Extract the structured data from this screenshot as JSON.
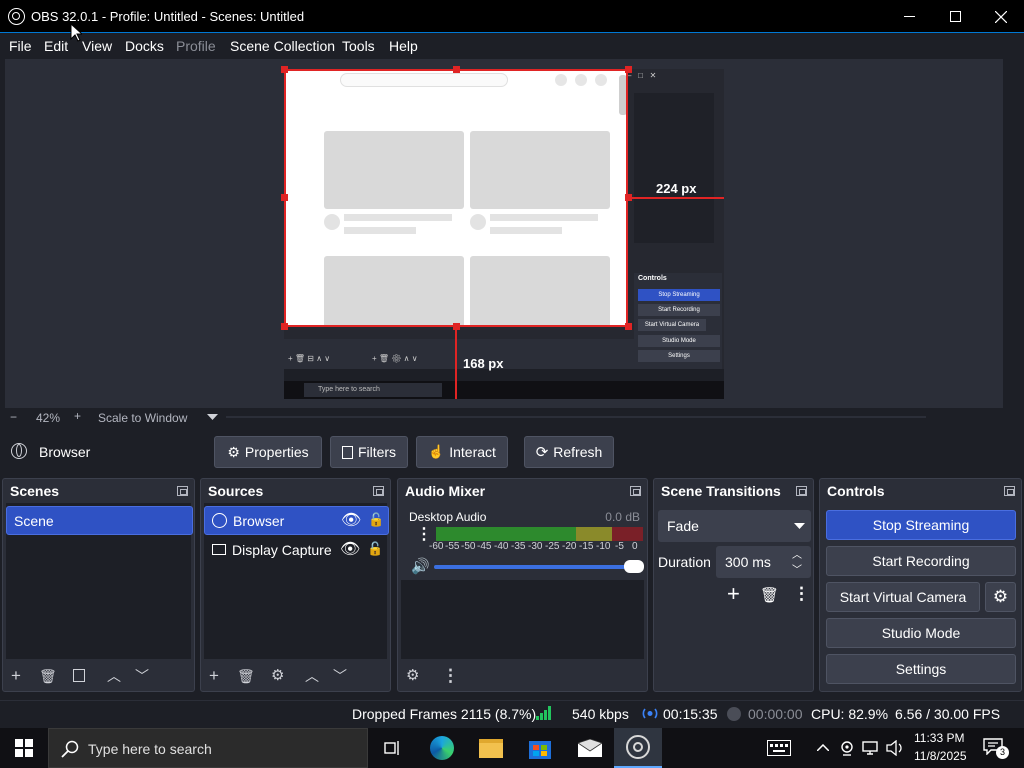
{
  "titlebar": {
    "title": "OBS 32.0.1 - Profile: Untitled - Scenes: Untitled"
  },
  "menu": {
    "items": [
      "File",
      "Edit",
      "View",
      "Docks",
      "Profile",
      "Scene Collection",
      "Tools",
      "Help"
    ]
  },
  "preview": {
    "crop_right_label": "224 px",
    "crop_bottom_label": "168 px",
    "inner_controls_title": "Controls",
    "inner_buttons": [
      "Stop Streaming",
      "Start Recording",
      "Start Virtual Camera",
      "Studio Mode",
      "Settings"
    ],
    "inner_search": "Type here to search"
  },
  "zoombar": {
    "minus": "−",
    "zoom": "42%",
    "plus": "+",
    "mode": "Scale to Window"
  },
  "source_toolbar": {
    "selected_source": "Browser",
    "properties": "Properties",
    "filters": "Filters",
    "interact": "Interact",
    "refresh": "Refresh"
  },
  "scenes": {
    "title": "Scenes",
    "items": [
      "Scene"
    ]
  },
  "sources": {
    "title": "Sources",
    "items": [
      "Browser",
      "Display Capture"
    ]
  },
  "audio": {
    "title": "Audio Mixer",
    "channel": "Desktop Audio",
    "level": "0.0 dB",
    "ticks": [
      "-60",
      "-55",
      "-50",
      "-45",
      "-40",
      "-35",
      "-30",
      "-25",
      "-20",
      "-15",
      "-10",
      "-5",
      "0"
    ],
    "volume_fraction": 1.0
  },
  "transitions": {
    "title": "Scene Transitions",
    "selected": "Fade",
    "duration_label": "Duration",
    "duration": "300 ms"
  },
  "controls": {
    "title": "Controls",
    "stop_streaming": "Stop Streaming",
    "start_recording": "Start Recording",
    "start_virtual_camera": "Start Virtual Camera",
    "studio_mode": "Studio Mode",
    "settings": "Settings"
  },
  "status": {
    "dropped": "Dropped Frames 2115 (8.7%)",
    "bitrate": "540 kbps",
    "stream_time": "00:15:35",
    "rec_time": "00:00:00",
    "cpu": "CPU: 82.9%",
    "fps": "6.56 / 30.00 FPS"
  },
  "taskbar": {
    "search_placeholder": "Type here to search",
    "time": "11:33 PM",
    "date": "11/8/2025",
    "notifications": "3"
  },
  "colors": {
    "accent": "#2f52c4",
    "crop_red": "#e02424",
    "window_bg": "#1d1f26",
    "dock_bg": "#2b2e38"
  }
}
